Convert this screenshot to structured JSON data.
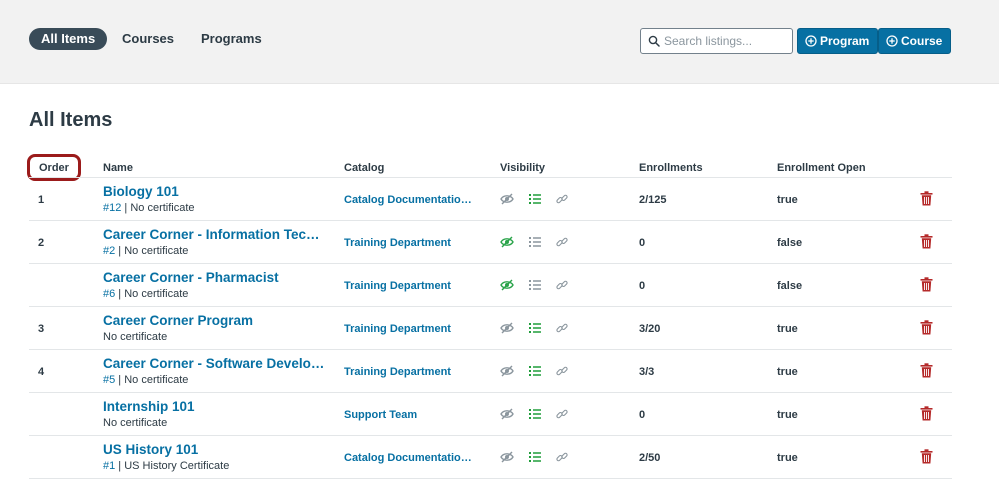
{
  "nav": {
    "tabs": [
      {
        "label": "All Items",
        "active": true
      },
      {
        "label": "Courses",
        "active": false
      },
      {
        "label": "Programs",
        "active": false
      }
    ]
  },
  "toolbar": {
    "search_placeholder": "Search listings...",
    "add_program_label": "Program",
    "add_course_label": "Course"
  },
  "page": {
    "title": "All Items"
  },
  "table": {
    "headers": {
      "order": "Order",
      "name": "Name",
      "catalog": "Catalog",
      "visibility": "Visibility",
      "enrollments": "Enrollments",
      "enrollment_open": "Enrollment Open"
    },
    "rows": [
      {
        "order": "1",
        "name": "Biology 101",
        "ref": "#12",
        "meta": " | No certificate",
        "catalog": "Catalog Documentation …",
        "visible": false,
        "listed": true,
        "enrollments": "2/125",
        "open": "true"
      },
      {
        "order": "2",
        "name": "Career Corner - Information Tech…",
        "ref": "#2",
        "meta": " | No certificate",
        "catalog": "Training Department",
        "visible": true,
        "listed": false,
        "enrollments": "0",
        "open": "false"
      },
      {
        "order": "",
        "name": "Career Corner - Pharmacist",
        "ref": "#6",
        "meta": " | No certificate",
        "catalog": "Training Department",
        "visible": true,
        "listed": false,
        "enrollments": "0",
        "open": "false"
      },
      {
        "order": "3",
        "name": "Career Corner Program",
        "ref": "",
        "meta": "No certificate",
        "catalog": "Training Department",
        "visible": false,
        "listed": true,
        "enrollments": "3/20",
        "open": "true"
      },
      {
        "order": "4",
        "name": "Career Corner - Software Develop…",
        "ref": "#5",
        "meta": " | No certificate",
        "catalog": "Training Department",
        "visible": false,
        "listed": true,
        "enrollments": "3/3",
        "open": "true"
      },
      {
        "order": "",
        "name": "Internship 101",
        "ref": "",
        "meta": "No certificate",
        "catalog": "Support Team",
        "visible": false,
        "listed": true,
        "enrollments": "0",
        "open": "true"
      },
      {
        "order": "",
        "name": "US History 101",
        "ref": "#1",
        "meta": " | US History Certificate",
        "catalog": "Catalog Documentation …",
        "visible": false,
        "listed": true,
        "enrollments": "2/50",
        "open": "true"
      }
    ]
  },
  "colors": {
    "brand": "#0770a3",
    "active_tab": "#394b58",
    "visible_green": "#2aa44a",
    "list_green": "#1f9d3a",
    "muted_icon": "#8b969e",
    "delete_red": "#b52a2a",
    "highlight": "#9b1b1b"
  },
  "icons": {
    "search": "search-icon",
    "plus": "plus-circle-icon",
    "visibility": "eye-icon",
    "list": "list-icon",
    "link": "link-icon",
    "delete": "trash-icon"
  }
}
